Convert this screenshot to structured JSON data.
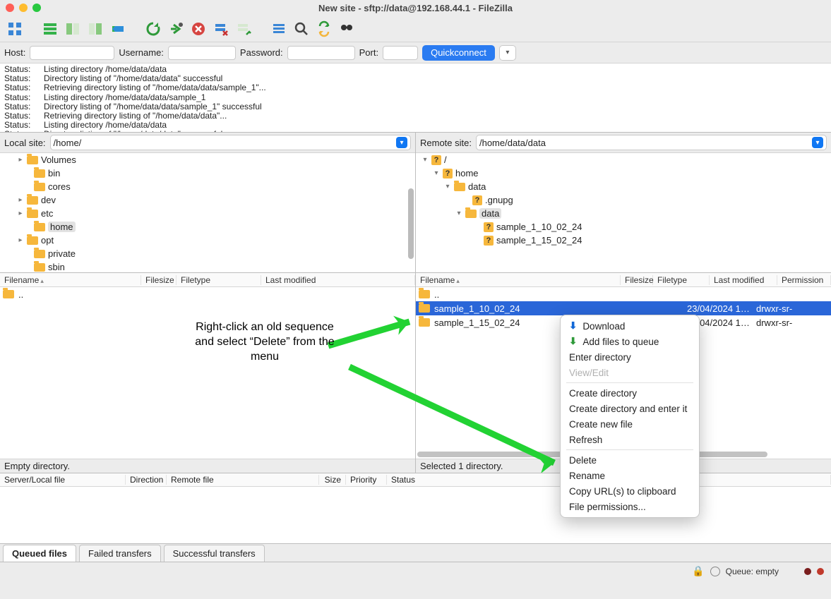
{
  "title": "New site - sftp://data@192.168.44.1 - FileZilla",
  "quickbar": {
    "host_label": "Host:",
    "user_label": "Username:",
    "pass_label": "Password:",
    "port_label": "Port:",
    "connect_label": "Quickconnect"
  },
  "log": [
    {
      "label": "Status:",
      "msg": "Listing directory /home/data/data"
    },
    {
      "label": "Status:",
      "msg": "Directory listing of \"/home/data/data\" successful"
    },
    {
      "label": "Status:",
      "msg": "Retrieving directory listing of \"/home/data/data/sample_1\"..."
    },
    {
      "label": "Status:",
      "msg": "Listing directory /home/data/data/sample_1"
    },
    {
      "label": "Status:",
      "msg": "Directory listing of \"/home/data/data/sample_1\" successful"
    },
    {
      "label": "Status:",
      "msg": "Retrieving directory listing of \"/home/data/data\"..."
    },
    {
      "label": "Status:",
      "msg": "Listing directory /home/data/data"
    },
    {
      "label": "Status:",
      "msg": "Directory listing of \"/home/data/data\" successful"
    }
  ],
  "local": {
    "label": "Local site:",
    "path": "/home/",
    "tree": [
      {
        "indent": 24,
        "tw": ">",
        "name": "Volumes",
        "icon": "f"
      },
      {
        "indent": 34,
        "tw": "",
        "name": "bin",
        "icon": "f"
      },
      {
        "indent": 34,
        "tw": "",
        "name": "cores",
        "icon": "f"
      },
      {
        "indent": 24,
        "tw": ">",
        "name": "dev",
        "icon": "f"
      },
      {
        "indent": 24,
        "tw": ">",
        "name": "etc",
        "icon": "f"
      },
      {
        "indent": 34,
        "tw": "",
        "name": "home",
        "icon": "f",
        "sel": true
      },
      {
        "indent": 24,
        "tw": ">",
        "name": "opt",
        "icon": "f"
      },
      {
        "indent": 34,
        "tw": "",
        "name": "private",
        "icon": "f"
      },
      {
        "indent": 34,
        "tw": "",
        "name": "sbin",
        "icon": "f"
      }
    ],
    "file_up": "..",
    "status": "Empty directory."
  },
  "remote": {
    "label": "Remote site:",
    "path": "/home/data/data",
    "tree": [
      {
        "indent": 8,
        "tw": "v",
        "name": "/",
        "icon": "q"
      },
      {
        "indent": 24,
        "tw": "v",
        "name": "home",
        "icon": "q"
      },
      {
        "indent": 40,
        "tw": "v",
        "name": "data",
        "icon": "f"
      },
      {
        "indent": 66,
        "tw": "",
        "name": ".gnupg",
        "icon": "q"
      },
      {
        "indent": 56,
        "tw": "v",
        "name": "data",
        "icon": "f",
        "sel": true
      },
      {
        "indent": 82,
        "tw": "",
        "name": "sample_1_10_02_24",
        "icon": "q"
      },
      {
        "indent": 82,
        "tw": "",
        "name": "sample_1_15_02_24",
        "icon": "q"
      }
    ],
    "files": [
      {
        "name": "sample_1_10_02_24",
        "mod": "23/04/2024 1…",
        "perm": "drwxr-sr-",
        "selected": true
      },
      {
        "name": "sample_1_15_02_24",
        "mod": "23/04/2024 1…",
        "perm": "drwxr-sr-"
      }
    ],
    "file_up": "..",
    "status": "Selected 1 directory."
  },
  "filecols": {
    "name": "Filename",
    "size": "Filesize",
    "type": "Filetype",
    "mod": "Last modified",
    "perm": "Permission"
  },
  "queue_cols": {
    "server": "Server/Local file",
    "dir": "Direction",
    "remote": "Remote file",
    "size": "Size",
    "priority": "Priority",
    "status": "Status"
  },
  "tabs": {
    "queued": "Queued files",
    "failed": "Failed transfers",
    "success": "Successful transfers"
  },
  "bottom": {
    "queue": "Queue: empty"
  },
  "ctx": {
    "download": "Download",
    "addq": "Add files to queue",
    "enter": "Enter directory",
    "viewedit": "View/Edit",
    "createdir": "Create directory",
    "createenter": "Create directory and enter it",
    "newfile": "Create new file",
    "refresh": "Refresh",
    "delete": "Delete",
    "rename": "Rename",
    "copyurl": "Copy URL(s) to clipboard",
    "fileperm": "File permissions..."
  },
  "annotation": "Right-click an old sequence and select “Delete” from the menu"
}
